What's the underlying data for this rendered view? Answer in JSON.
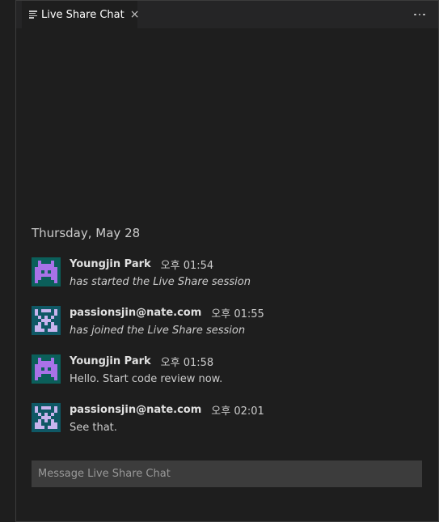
{
  "tab": {
    "label": "Live Share Chat",
    "icon": "list-icon",
    "close_glyph": "×"
  },
  "toolbar": {
    "more_icon": "more-actions-icon"
  },
  "chat": {
    "date_header": "Thursday, May 28",
    "messages": [
      {
        "author": "Youngjin Park",
        "time": "오후 01:54",
        "text": "has started the Live Share session",
        "system": true,
        "avatar_icon": "identicon-youngjin",
        "avatar_fg": "#a872e8",
        "avatar_bg": "#0b5f5a"
      },
      {
        "author": "passionsjin@nate.com",
        "time": "오후 01:55",
        "text": "has joined the Live Share session",
        "system": true,
        "avatar_icon": "identicon-passionsjin",
        "avatar_fg": "#c8b4ee",
        "avatar_bg": "#0f5865"
      },
      {
        "author": "Youngjin Park",
        "time": "오후 01:58",
        "text": "Hello. Start code review now.",
        "system": false,
        "avatar_icon": "identicon-youngjin",
        "avatar_fg": "#a872e8",
        "avatar_bg": "#0b5f5a"
      },
      {
        "author": "passionsjin@nate.com",
        "time": "오후 02:01",
        "text": "See that.",
        "system": false,
        "avatar_icon": "identicon-passionsjin",
        "avatar_fg": "#c8b4ee",
        "avatar_bg": "#0f5865"
      }
    ]
  },
  "composer": {
    "placeholder": "Message Live Share Chat",
    "value": ""
  },
  "colors": {
    "background": "#1e1e1e",
    "tabbar": "#252526",
    "input_bg": "#3c3c3c",
    "text": "#cccccc"
  }
}
